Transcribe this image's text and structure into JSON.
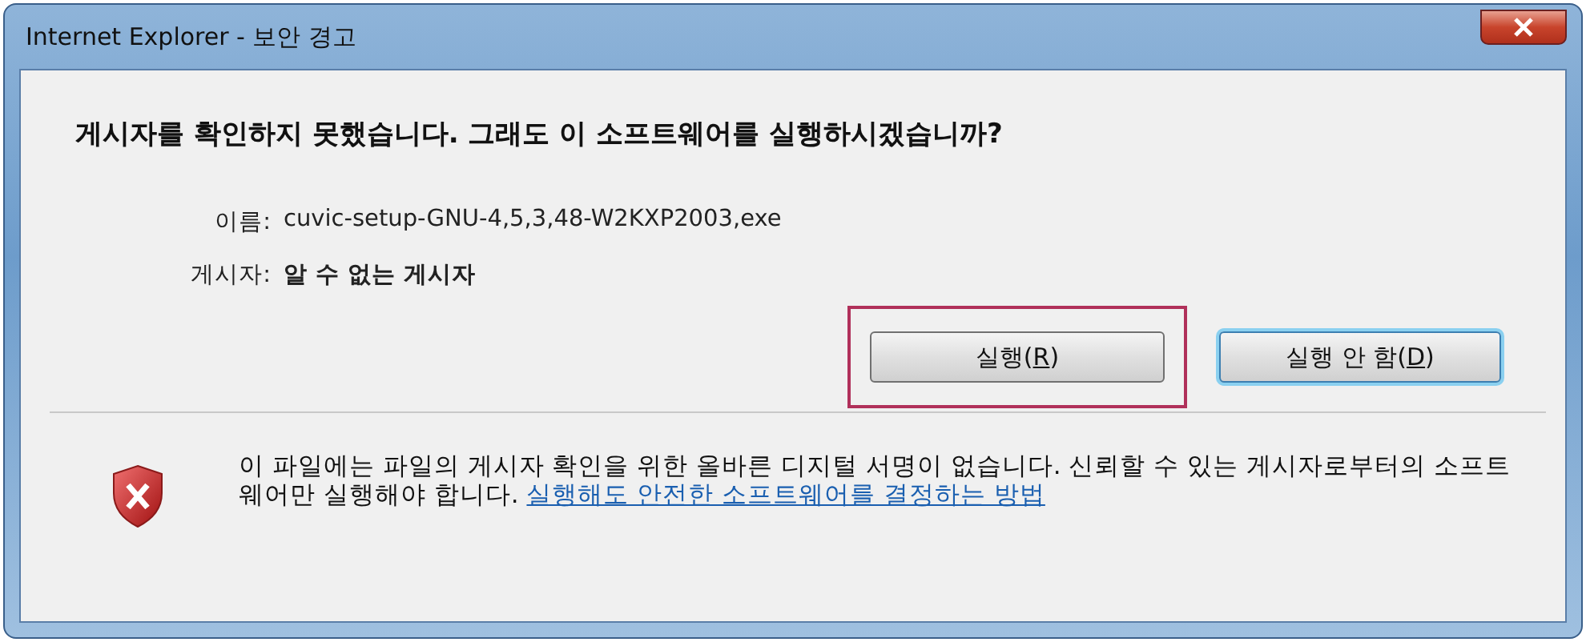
{
  "window": {
    "title": "Internet Explorer - 보안 경고"
  },
  "heading": "게시자를 확인하지 못했습니다. 그래도 이 소프트웨어를 실행하시겠습니까?",
  "fields": [
    {
      "label": "이름:",
      "value": "cuvic-setup-GNU-4,5,3,48-W2KXP2003,exe",
      "bold": false
    },
    {
      "label": "게시자:",
      "value": "알 수 없는 게시자",
      "bold": true
    }
  ],
  "buttons": [
    {
      "before": "실행(",
      "key": "R",
      "after": ")",
      "default": false,
      "highlighted": true
    },
    {
      "before": "실행 안 함(",
      "key": "D",
      "after": ")",
      "default": true,
      "highlighted": false
    }
  ],
  "warning": {
    "text": "이 파일에는 파일의 게시자 확인을 위한 올바른 디지털 서명이 없습니다. 신뢰할 수 있는 게시자로부터의 소프트웨어만 실행해야 합니다.",
    "link": "실행해도 안전한 소프트웨어를 결정하는 방법"
  }
}
